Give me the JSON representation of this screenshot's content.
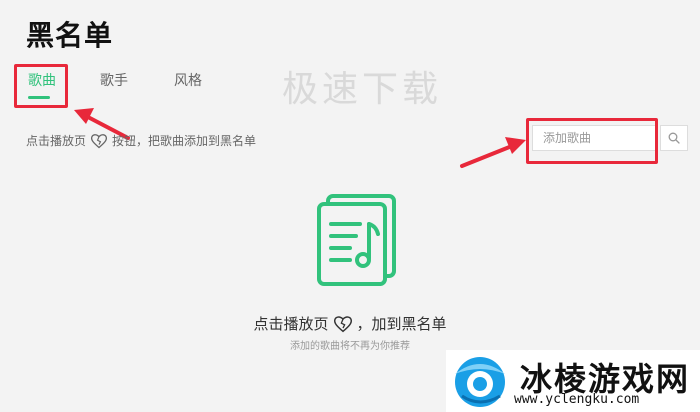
{
  "page": {
    "title": "黑名单"
  },
  "tabs": [
    {
      "label": "歌曲",
      "active": true
    },
    {
      "label": "歌手",
      "active": false
    },
    {
      "label": "风格",
      "active": false
    }
  ],
  "watermark": "极速下载",
  "hint": {
    "before": "点击播放页",
    "after": "按钮，把歌曲添加到黑名单"
  },
  "search": {
    "placeholder": "添加歌曲"
  },
  "empty": {
    "title_before": "点击播放页",
    "title_after": "，加到黑名单",
    "subtitle": "添加的歌曲将不再为你推荐"
  },
  "site_logo": {
    "name": "冰棱游戏网",
    "url": "www.yclengku.com"
  },
  "colors": {
    "accent": "#31c27c",
    "highlight": "#e8283a"
  },
  "icons": [
    "broken-heart-icon",
    "search-icon",
    "music-files-icon",
    "red-arrow-icon"
  ]
}
